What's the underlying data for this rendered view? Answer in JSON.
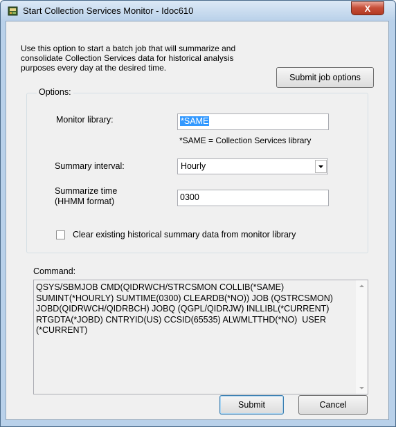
{
  "window": {
    "title": "Start Collection Services Monitor - Idoc610",
    "close_label": "X"
  },
  "intro_text": "Use this option to start a batch job that will summarize and consolidate Collection Services data for historical analysis purposes every day at the desired time.",
  "submit_job_options_label": "Submit job options",
  "options": {
    "legend": "Options:",
    "monitor_library_label": "Monitor library:",
    "monitor_library_value": "*SAME",
    "monitor_library_hint": "*SAME = Collection Services library",
    "summary_interval_label": "Summary interval:",
    "summary_interval_value": "Hourly",
    "summarize_time_label_line1": "Summarize time",
    "summarize_time_label_line2": "(HHMM format)",
    "summarize_time_value": "0300",
    "clear_checkbox_label": "Clear existing historical summary data from monitor library",
    "clear_checkbox_checked": false
  },
  "command": {
    "label": "Command:",
    "text": "QSYS/SBMJOB CMD(QIDRWCH/STRCSMON COLLIB(*SAME) SUMINT(*HOURLY) SUMTIME(0300) CLEARDB(*NO)) JOB (QSTRCSMON) JOBD(QIDRWCH/QIDRBCH) JOBQ (QGPL/QIDRJW) INLLIBL(*CURRENT) RTGDTA(*JOBD) CNTRYID(US) CCSID(65535) ALWMLTTHD(*NO)  USER (*CURRENT)"
  },
  "buttons": {
    "submit": "Submit",
    "cancel": "Cancel"
  },
  "colors": {
    "title_bar": "#c4d8ee",
    "close_button": "#c7503a",
    "selection": "#3399ff",
    "dialog_bg": "#f0f0f0"
  }
}
